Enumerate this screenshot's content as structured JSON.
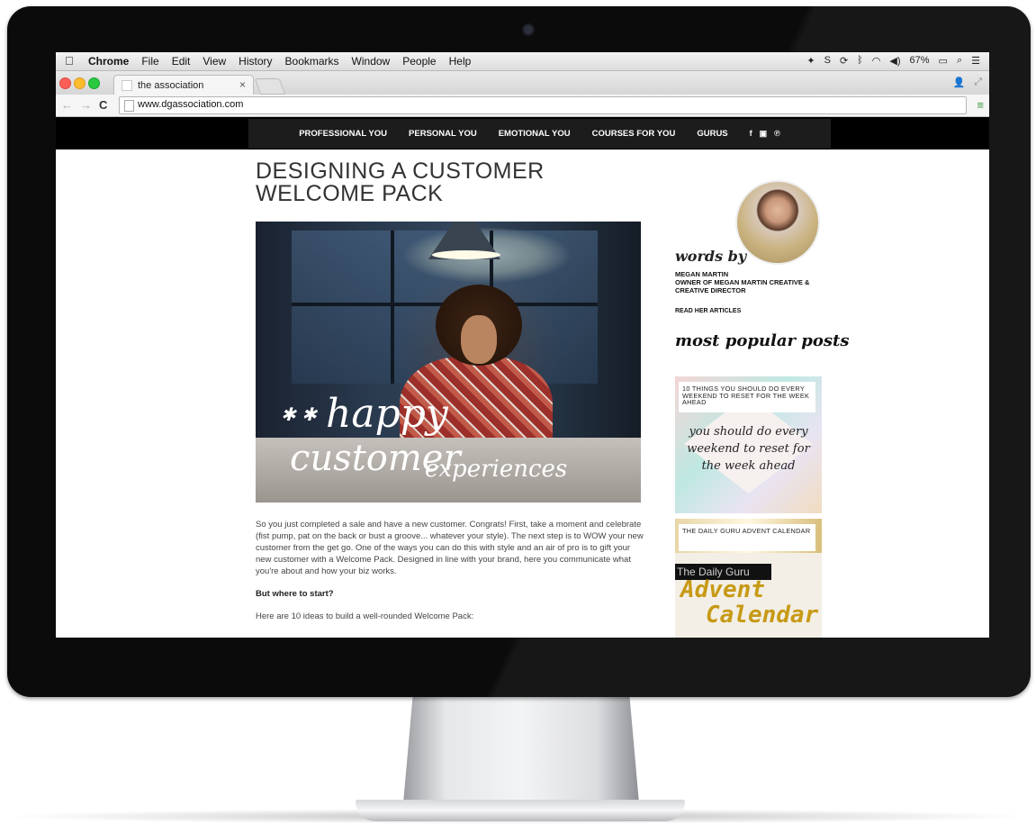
{
  "menubar": {
    "app": "Chrome",
    "items": [
      "File",
      "Edit",
      "View",
      "History",
      "Bookmarks",
      "Window",
      "People",
      "Help"
    ],
    "status": [
      "S",
      "67%"
    ]
  },
  "tab": {
    "title": "the association",
    "close": "×"
  },
  "toolbar": {
    "back": "←",
    "forward": "→",
    "reload": "C",
    "url": "www.dgassociation.com",
    "menu": "≡"
  },
  "site": {
    "nav": [
      "PROFESSIONAL YOU",
      "PERSONAL YOU",
      "EMOTIONAL YOU",
      "COURSES FOR YOU",
      "GURUS"
    ],
    "social": [
      "f",
      "▣",
      "℗"
    ]
  },
  "article": {
    "title": "DESIGNING A CUSTOMER WELCOME PACK",
    "hero_overlay": {
      "stars": "✱ ✱",
      "line1": "happy",
      "line2": "customer",
      "line3": "experiences"
    },
    "paragraph1": "So you just completed a sale and have a new customer. Congrats! First, take a moment and celebrate (fist pump, pat on the back or bust a groove... whatever your style). The next step is to WOW your new customer from the get go. One of the ways you can do this with style and an air of pro is to gift your new customer with a Welcome Pack. Designed in line with your brand, here you communicate what you're about and how your biz works.",
    "subheading": "But where to start?",
    "paragraph2": "Here are 10 ideas to build a well-rounded Welcome Pack:"
  },
  "sidebar": {
    "words_by": "words by",
    "author_name": "MEGAN MARTIN",
    "author_role": "OWNER OF MEGAN MARTIN CREATIVE & CREATIVE DIRECTOR",
    "read_more": "READ HER ARTICLES",
    "popular_heading": "most popular posts",
    "posts": [
      {
        "label": "10 THINGS YOU SHOULD DO EVERY WEEKEND TO RESET FOR THE WEEK AHEAD",
        "image_text": "you should do every weekend to reset for the week ahead"
      },
      {
        "label": "THE DAILY GURU ADVENT CALENDAR",
        "image_banner": "The Daily Guru",
        "image_line1": "Advent",
        "image_line2": "Calendar"
      }
    ]
  }
}
